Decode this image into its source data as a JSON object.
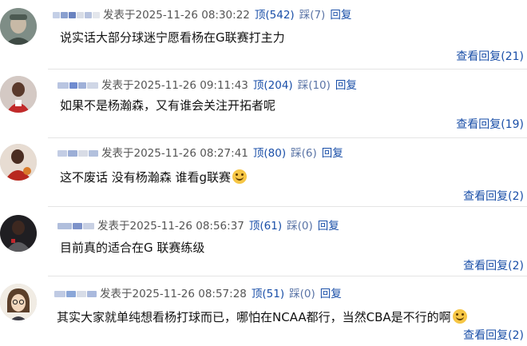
{
  "comments": [
    {
      "posted_label": "发表于2025-11-26 08:30:22",
      "like": "顶(542)",
      "dislike": "踩(7)",
      "reply": "回复",
      "text": "说实话大部分球迷宁愿看杨在G联赛打主力",
      "view_replies": "查看回复(21)",
      "avatar_icon": "elderly-man-portrait",
      "name_colors": [
        "#c4cfe6",
        "#8aa0cf",
        "#6a83c0",
        "#d9dde6",
        "#b7c3de",
        "#e3e6ec"
      ]
    },
    {
      "posted_label": "发表于2025-11-26 09:11:43",
      "like": "顶(204)",
      "dislike": "踩(10)",
      "reply": "回复",
      "text": "如果不是杨瀚森，又有谁会关注开拓者呢",
      "view_replies": "查看回复(19)",
      "avatar_icon": "basketball-player-portrait",
      "name_colors": [
        "#b9c5e1",
        "#6f8bd0",
        "#9fb0d8",
        "#cfd6e6"
      ]
    },
    {
      "posted_label": "发表于2025-11-26 08:27:41",
      "like": "顶(80)",
      "dislike": "踩(6)",
      "reply": "回复",
      "text": "这不废话 没有杨瀚森 谁看g联赛",
      "emoji": "crying-laughing-emoji",
      "view_replies": "查看回复(2)",
      "avatar_icon": "basketball-player-portrait",
      "name_colors": [
        "#c3cde4",
        "#9caed6",
        "#d8dce6",
        "#b2c0dd"
      ]
    },
    {
      "posted_label": "发表于2025-11-26 08:56:37",
      "like": "顶(61)",
      "dislike": "踩(0)",
      "reply": "回复",
      "text": "目前真的适合在G 联赛练级",
      "view_replies": "查看回复(2)",
      "avatar_icon": "basketball-player-portrait",
      "name_colors": [
        "#b0bedc",
        "#7d92c9",
        "#c8d0e3"
      ]
    },
    {
      "posted_label": "发表于2025-11-26 08:57:28",
      "like": "顶(51)",
      "dislike": "踩(0)",
      "reply": "回复",
      "text": "其实大家就单纯想看杨打球而已，哪怕在NCAA都行，当然CBA是不行的啊",
      "emoji": "smiling-emoji",
      "view_replies": "查看回复(2)",
      "avatar_icon": "cartoon-character-portrait",
      "name_colors": [
        "#bfcae3",
        "#8aa6d8",
        "#d7dce7",
        "#a9b9dd"
      ]
    }
  ]
}
